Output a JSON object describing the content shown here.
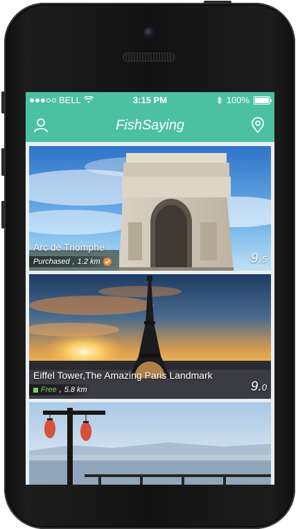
{
  "status_bar": {
    "carrier": "BELL",
    "time": "3:15 PM",
    "battery": "100%"
  },
  "nav": {
    "title": "FishSaying",
    "left_icon": "user-icon",
    "right_icon": "location-pin-icon"
  },
  "theme": {
    "accent": "#4bc1a1",
    "free_color": "#7bd35a",
    "badge_color": "#f08a3e"
  },
  "cards": [
    {
      "title": "Arc de Triomphe",
      "meta_status": "Purchased",
      "meta_distance": "1.2 km",
      "status_icon": "check-badge-icon",
      "score_major": "9.",
      "score_minor": "5"
    },
    {
      "title": "Eiffel Tower,The Amazing Paris Landmark",
      "meta_status": "Free",
      "meta_distance": "5.8 km",
      "status_icon": "free-square-icon",
      "score_major": "9.",
      "score_minor": "0"
    },
    {
      "title": "",
      "scene": "waterfront-with-lanterns"
    }
  ]
}
